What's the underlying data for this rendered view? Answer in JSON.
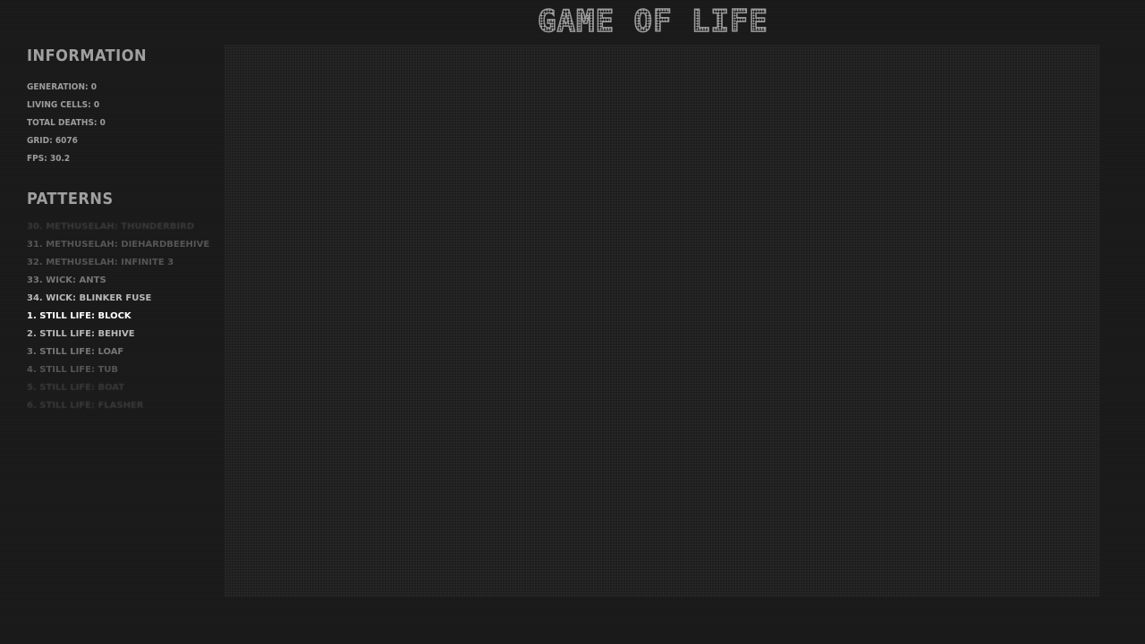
{
  "title": "GAME OF LIFE",
  "information": {
    "heading": "INFORMATION",
    "lines": [
      "GENERATION: 0",
      "LIVING CELLS: 0",
      "TOTAL DEATHS: 0",
      "GRID: 6076",
      "FPS: 30.2"
    ]
  },
  "patterns": {
    "heading": "PATTERNS",
    "items": [
      "30. METHUSELAH: THUNDERBIRD",
      "31. METHUSELAH: DIEHARDBEEHIVE",
      "32. METHUSELAH: INFINITE 3",
      "33. WICK: ANTS",
      "34. WICK: BLINKER FUSE",
      "1. STILL LIFE: BLOCK",
      "2. STILL LIFE: BEHIVE",
      "3. STILL LIFE: LOAF",
      "4. STILL LIFE: TUB",
      "5. STILL LIFE: BOAT",
      "6. STILL LIFE: FLASHER"
    ],
    "selected": "1. STILL LIFE: BLOCK"
  }
}
